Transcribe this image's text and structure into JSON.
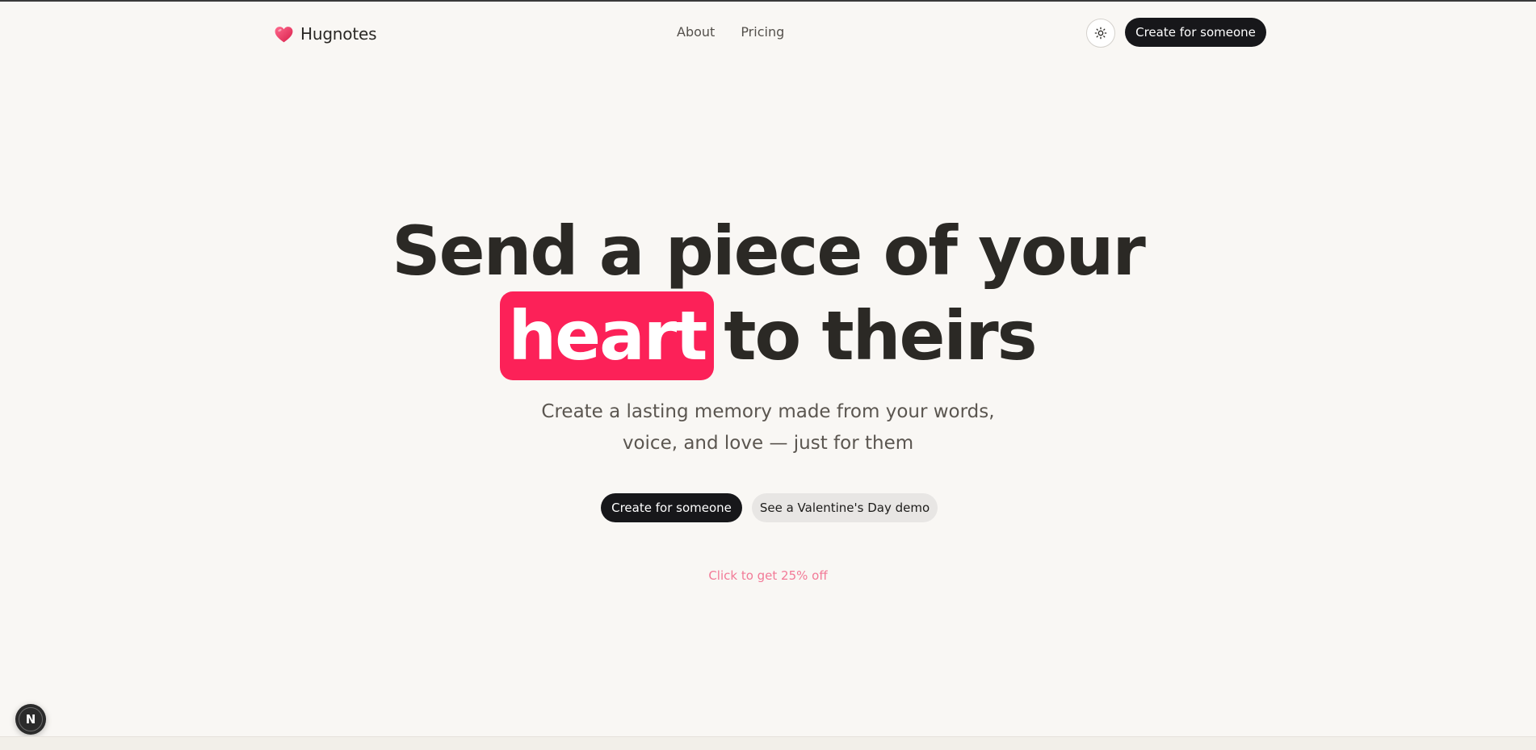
{
  "nav": {
    "brand_name": "Hugnotes",
    "links": [
      {
        "label": "About"
      },
      {
        "label": "Pricing"
      }
    ],
    "theme_toggle_icon": "sun-icon",
    "cta_label": "Create for someone"
  },
  "hero": {
    "title_line1": "Send a piece of your",
    "title_highlight": "heart",
    "title_line2_rest": "to theirs",
    "subtitle_line1": "Create a lasting memory made from your words,",
    "subtitle_line2": "voice, and love — just for them",
    "primary_cta": "Create for someone",
    "secondary_cta": "See a Valentine's Day demo",
    "promo": "Click to get 25% off"
  },
  "dev_badge": {
    "icon": "nextjs-icon",
    "letter": "N"
  },
  "colors": {
    "background": "#f9f7f4",
    "accent": "#fc2158",
    "dark_button": "#17171a",
    "light_button": "#e8e6e4",
    "promo_text": "#f27a97"
  }
}
